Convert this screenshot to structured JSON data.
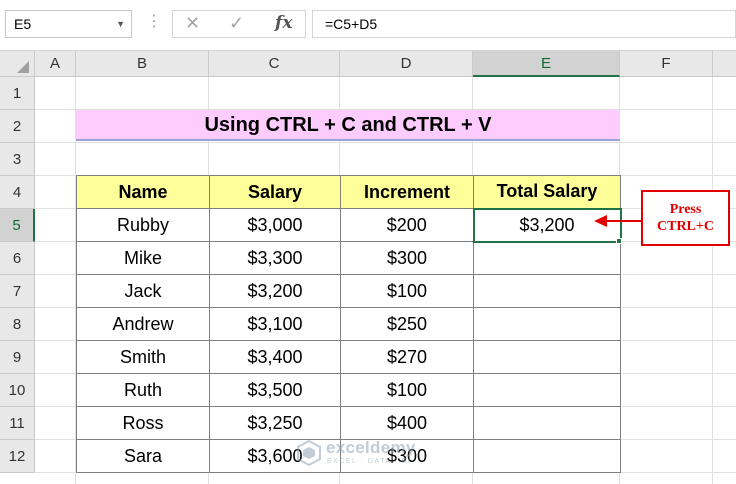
{
  "formula_bar": {
    "name_box": "E5",
    "name_box_dropdown": "▼",
    "dots": "⋮",
    "cancel_icon": "✕",
    "enter_icon": "✓",
    "fx_label": "fx",
    "formula": "=C5+D5"
  },
  "columns": [
    "A",
    "B",
    "C",
    "D",
    "E",
    "F"
  ],
  "selected_column": "E",
  "rows": [
    "1",
    "2",
    "3",
    "4",
    "5",
    "6",
    "7",
    "8",
    "9",
    "10",
    "11",
    "12"
  ],
  "selected_row": "5",
  "title": "Using CTRL + C and CTRL + V",
  "table": {
    "headers": [
      "Name",
      "Salary",
      "Increment",
      "Total Salary"
    ],
    "rows": [
      [
        "Rubby",
        "$3,000",
        "$200",
        "$3,200"
      ],
      [
        "Mike",
        "$3,300",
        "$300",
        ""
      ],
      [
        "Jack",
        "$3,200",
        "$100",
        ""
      ],
      [
        "Andrew",
        "$3,100",
        "$250",
        ""
      ],
      [
        "Smith",
        "$3,400",
        "$270",
        ""
      ],
      [
        "Ruth",
        "$3,500",
        "$100",
        ""
      ],
      [
        "Ross",
        "$3,250",
        "$400",
        ""
      ],
      [
        "Sara",
        "$3,600",
        "$300",
        ""
      ]
    ]
  },
  "callout": {
    "line1": "Press",
    "line2": "CTRL+C",
    "color": "#e00000"
  },
  "watermark": {
    "name": "exceldemy",
    "tagline": "EXCEL · DATA · BI"
  },
  "colors": {
    "title_bg": "#ffccff",
    "header_bg": "#ffff99",
    "selection": "#217346"
  }
}
